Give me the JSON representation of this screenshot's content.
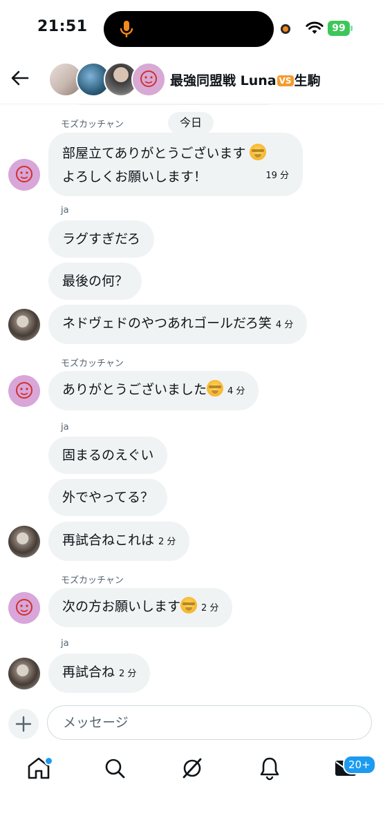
{
  "status_bar": {
    "time": "21:51",
    "battery": "99"
  },
  "header": {
    "title_prefix": "最強同盟戦 ",
    "title_left": "Luna",
    "vs_label": "VS",
    "title_right": "生駒"
  },
  "chat": {
    "date_divider": "今日",
    "messages": [
      {
        "sender": "モズカッチャン",
        "line1": "部屋立てありがとうございます",
        "line2": "よろしくお願いします！",
        "time": "19 分"
      },
      {
        "sender": "ja",
        "text": "ラグすぎだろ"
      },
      {
        "text": "最後の何？"
      },
      {
        "text": "ネドヴェドのやつあれゴールだろ笑",
        "time": "4 分"
      },
      {
        "sender": "モズカッチャン",
        "text": "ありがとうございました",
        "time": "4 分"
      },
      {
        "sender": "ja",
        "text": "固まるのえぐい"
      },
      {
        "text": "外でやってる？"
      },
      {
        "text": "再試合ねこれは",
        "time": "2 分"
      },
      {
        "sender": "モズカッチャン",
        "text": "次の方お願いします",
        "time": "2 分"
      },
      {
        "sender": "ja",
        "text": "再試合ね",
        "time": "2 分"
      }
    ]
  },
  "composer": {
    "placeholder": "メッセージ"
  },
  "nav": {
    "messages_badge": "20+",
    "accent_color": "#1d9bf0"
  }
}
